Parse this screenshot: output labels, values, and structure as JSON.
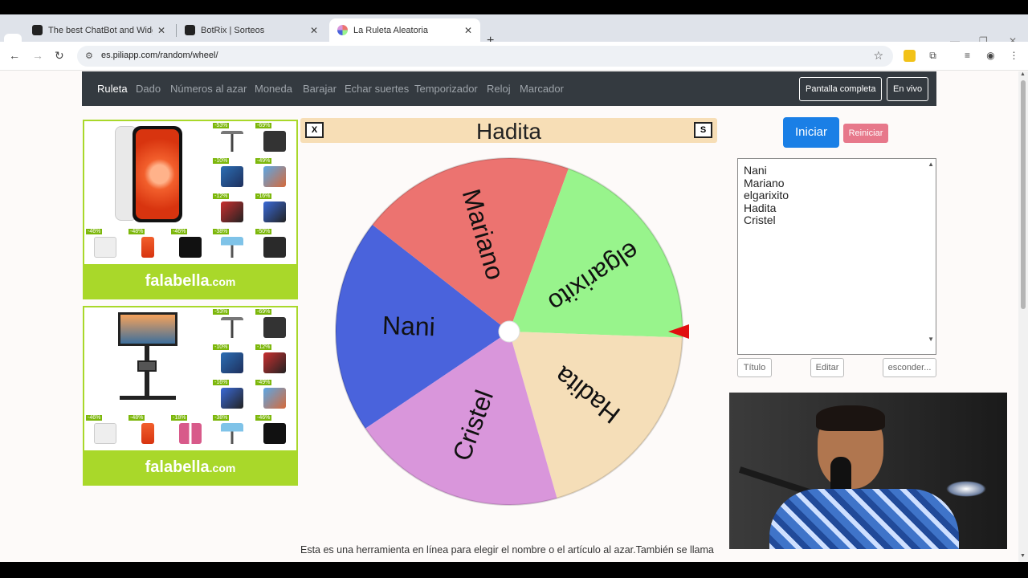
{
  "browser": {
    "tabs": [
      {
        "title": "The best ChatBot and Widgets",
        "icon": "github-icon"
      },
      {
        "title": "BotRix | Sorteos",
        "icon": "github-icon"
      },
      {
        "title": "La Ruleta Aleatoria",
        "icon": "piliapp-icon"
      }
    ],
    "url": "es.piliapp.com/random/wheel/"
  },
  "nav": {
    "items": [
      "Ruleta",
      "Dado",
      "Números al azar",
      "Moneda",
      "Barajar",
      "Echar suertes",
      "Temporizador",
      "Reloj",
      "Marcador"
    ],
    "fullscreen_label": "Pantalla completa",
    "live_label": "En vivo"
  },
  "ads": {
    "brand": "falabella",
    "brand_suffix": ".com",
    "top_badges": [
      "-53%",
      "-69%",
      "-10%",
      "-49%",
      "-12%",
      "-16%",
      "-46%",
      "-48%",
      "-46%",
      "-38%",
      "-50%"
    ],
    "bottom_badges": [
      "-53%",
      "-69%",
      "-10%",
      "-12%",
      "-16%",
      "-49%",
      "-46%",
      "-48%",
      "-18%",
      "-38%",
      "-46%"
    ]
  },
  "wheel": {
    "title": "Hadita",
    "close_label": "X",
    "s_label": "S",
    "segments": [
      {
        "name": "Nani",
        "color": "#4a63dc"
      },
      {
        "name": "Mariano",
        "color": "#ec7370"
      },
      {
        "name": "elgarixito",
        "color": "#98f48c"
      },
      {
        "name": "Hadita",
        "color": "#f5deb8"
      },
      {
        "name": "Cristel",
        "color": "#d996db"
      }
    ],
    "pointer_color": "#e10f0f"
  },
  "controls": {
    "start_label": "Iniciar",
    "reset_label": "Reiniciar",
    "names": [
      "Nani",
      "Mariano",
      "elgarixito",
      "Hadita",
      "Cristel"
    ],
    "title_btn": "Título",
    "edit_btn": "Editar",
    "hide_btn": "esconder..."
  },
  "description": "Esta es una herramienta en línea para elegir el nombre o el artículo al azar.También se llama"
}
